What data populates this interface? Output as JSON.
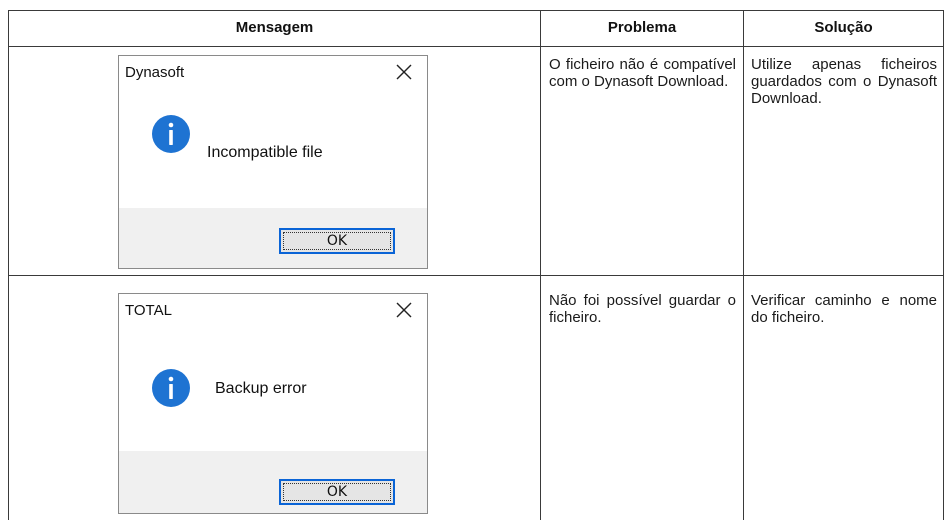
{
  "table": {
    "headers": {
      "message": "Mensagem",
      "problem": "Problema",
      "solution": "Solução"
    },
    "rows": [
      {
        "dialog": {
          "title": "Dynasoft",
          "message": "Incompatible file",
          "ok_label": "OK",
          "icon": "info-icon"
        },
        "problem": "O ficheiro não é compatível com o Dynasoft Download.",
        "solution": "Utilize apenas ficheiros guardados com o Dynasoft Download."
      },
      {
        "dialog": {
          "title": "TOTAL",
          "message": "Backup error",
          "ok_label": "OK",
          "icon": "info-icon"
        },
        "problem": "Não foi possível guardar o ficheiro.",
        "solution": "Verificar caminho e nome do ficheiro."
      }
    ]
  },
  "colors": {
    "info_icon": "#1e73d2",
    "ok_border": "#0a64d6",
    "dialog_footer": "#f0f0f0",
    "grid": "#3a3a3a"
  }
}
